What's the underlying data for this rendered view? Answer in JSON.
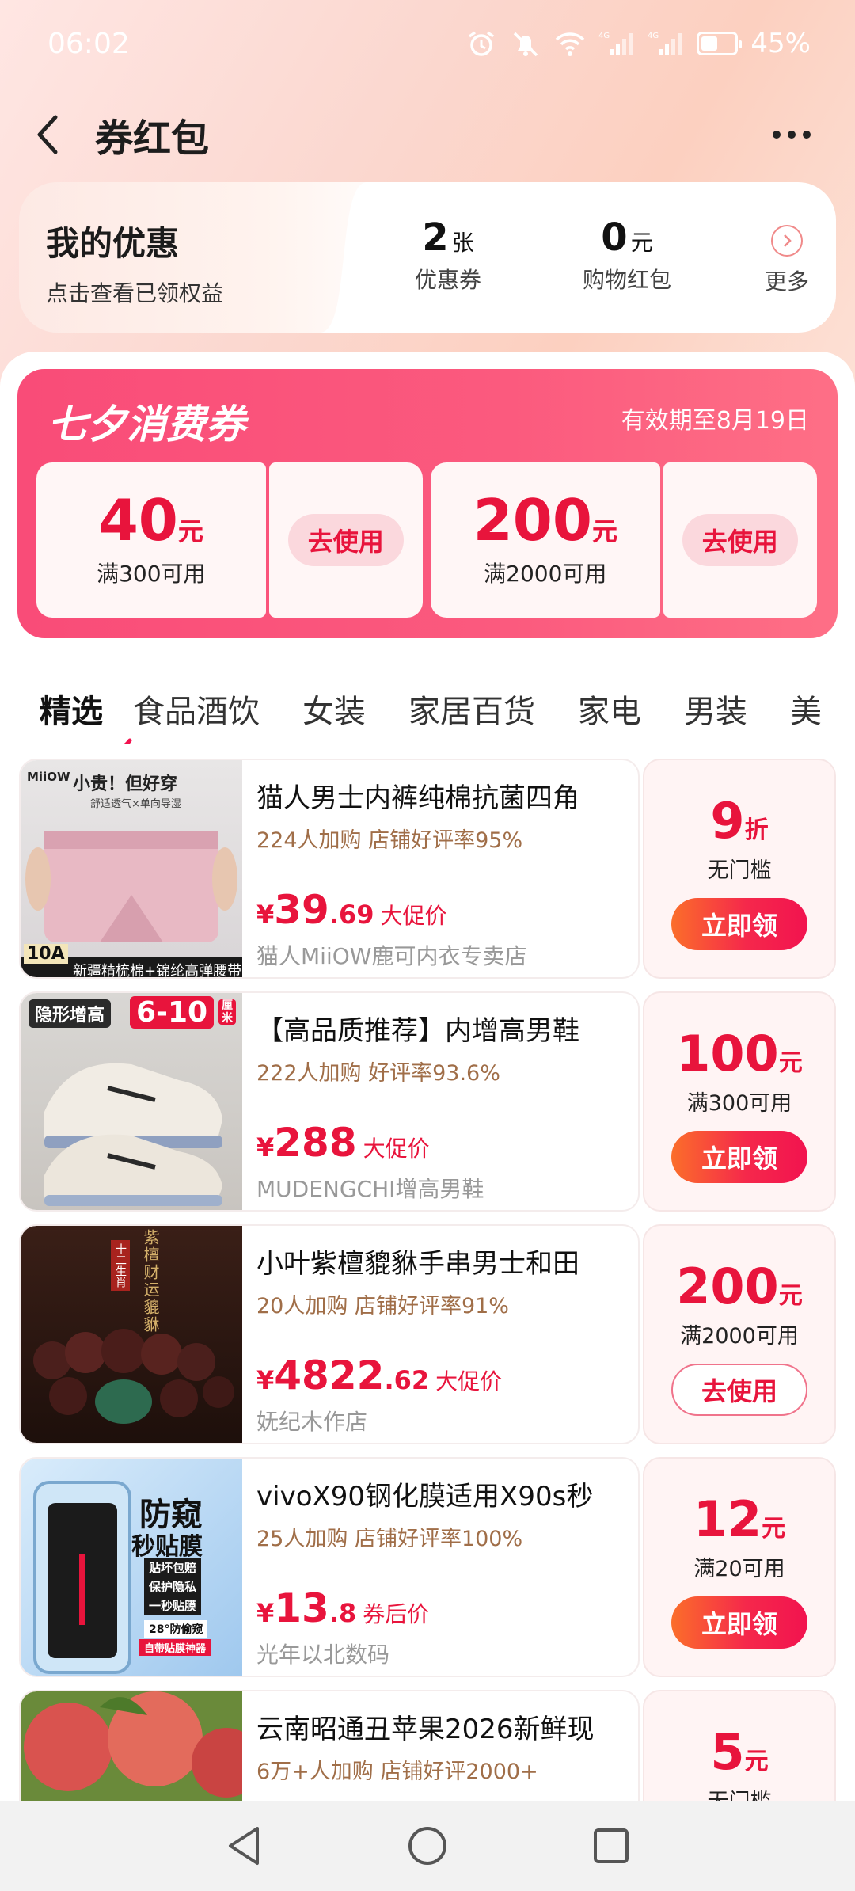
{
  "status_bar": {
    "time": "06:02",
    "battery": "45%",
    "net1": "4G",
    "net2": "4G"
  },
  "header": {
    "title": "券红包"
  },
  "benefits": {
    "title": "我的优惠",
    "subtitle": "点击查看已领权益",
    "coupons": {
      "num": "2",
      "unit": "张",
      "label": "优惠券"
    },
    "redpack": {
      "num": "0",
      "unit": "元",
      "label": "购物红包"
    },
    "more_label": "更多"
  },
  "banner": {
    "title": "七夕消费券",
    "expiry": "有效期至8月19日",
    "coupons": [
      {
        "amount": "40",
        "unit": "元",
        "condition": "满300可用",
        "button": "去使用"
      },
      {
        "amount": "200",
        "unit": "元",
        "condition": "满2000可用",
        "button": "去使用"
      }
    ]
  },
  "tabs": [
    "精选",
    "食品酒饮",
    "女装",
    "家居百货",
    "家电",
    "男装",
    "美"
  ],
  "products": [
    {
      "name": "猫人男士内裤纯棉抗菌四角",
      "meta": "224人加购  店铺好评率95%",
      "price_int": "39",
      "price_dec": ".69",
      "price_tag": "大促价",
      "shop": "猫人MiiOW鹿可内衣专卖店",
      "offer_num": "9",
      "offer_unit": "折",
      "offer_cond": "无门槛",
      "button": "立即领",
      "img_text1": "小贵！但好穿",
      "img_text2": "舒适透气×单向导湿",
      "img_text3": "新疆精梳棉+锦纶高弹腰带",
      "img_brand": "MiiOW",
      "img_badge": "10A"
    },
    {
      "name": "【高品质推荐】内增高男鞋",
      "meta": "222人加购  好评率93.6%",
      "price_int": "288",
      "price_dec": "",
      "price_tag": "大促价",
      "shop": "MUDENGCHI增高男鞋",
      "offer_num": "100",
      "offer_unit": "元",
      "offer_cond": "满300可用",
      "button": "立即领",
      "img_text1": "隐形增高",
      "img_text2": "6-10",
      "img_text3": "厘米"
    },
    {
      "name": "小叶紫檀貔貅手串男士和田",
      "meta": "20人加购  店铺好评率91%",
      "price_int": "4822",
      "price_dec": ".62",
      "price_tag": "大促价",
      "shop": "妩纪木作店",
      "offer_num": "200",
      "offer_unit": "元",
      "offer_cond": "满2000可用",
      "button": "去使用",
      "img_text1": "紫檀财运貔貅",
      "img_text2": "十二生肖"
    },
    {
      "name": "vivoX90钢化膜适用X90s秒",
      "meta": "25人加购  店铺好评率100%",
      "price_int": "13",
      "price_dec": ".8",
      "price_tag": "券后价",
      "shop": "光年以北数码",
      "offer_num": "12",
      "offer_unit": "元",
      "offer_cond": "满20可用",
      "button": "立即领",
      "img_text1": "防窥",
      "img_text2": "秒贴膜",
      "img_text3": "贴坏包赔",
      "img_text4": "保护隐私",
      "img_text5": "一秒贴膜",
      "img_text6": "28°防偷窥",
      "img_text7": "自带贴膜神器"
    },
    {
      "name": "云南昭通丑苹果2026新鲜现",
      "meta": "6万+人加购  店铺好评2000+",
      "price_int": "",
      "price_dec": "",
      "price_tag": "",
      "shop": "",
      "offer_num": "5",
      "offer_unit": "元",
      "offer_cond": "无门槛",
      "button": ""
    }
  ],
  "colors": {
    "accent": "#e8143c",
    "banner": "#f94c78",
    "meta": "#a06e48"
  }
}
